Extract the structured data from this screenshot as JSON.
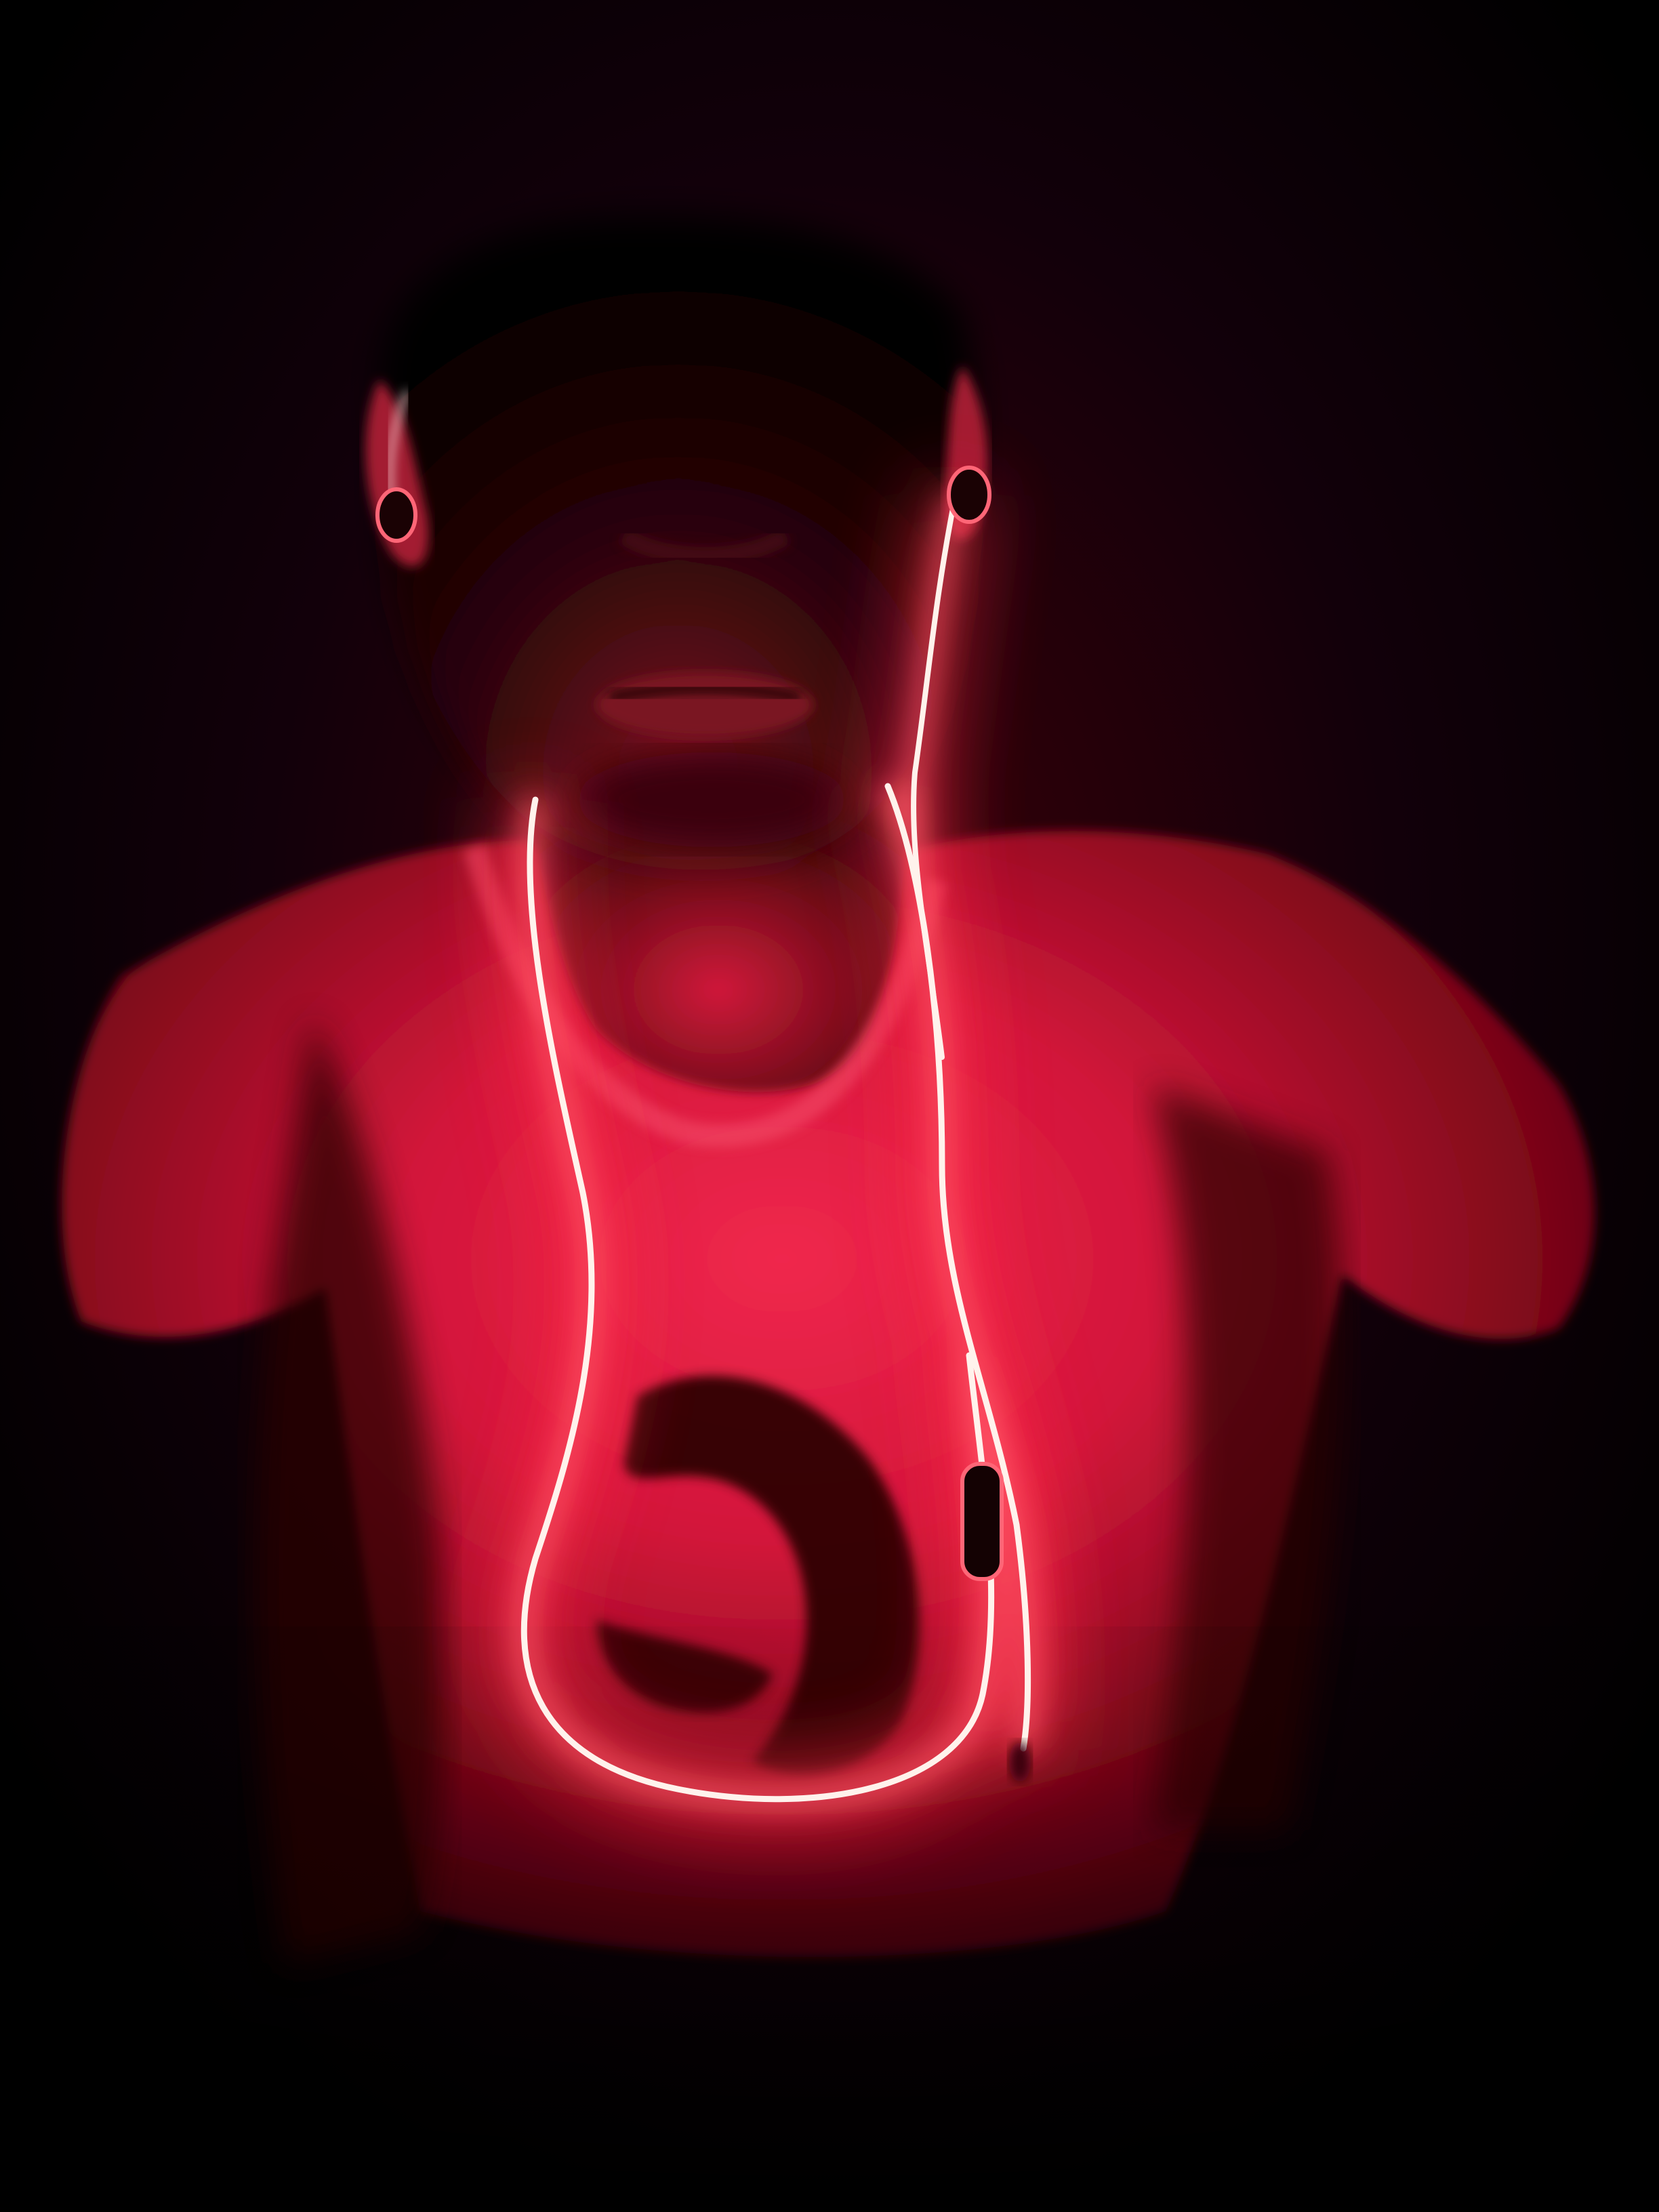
{
  "photo": {
    "subject": "person-with-glowing-earphones",
    "colors": {
      "background": "#000000",
      "shadow": "#1a0003",
      "shirt_dark": "#5a0010",
      "shirt_mid": "#b3102e",
      "shirt_light": "#f0284d",
      "skin_shadow": "#2a0508",
      "skin_lit": "#8a1424",
      "cable_core": "#fff2ec",
      "cable_glow": "#ff2a44",
      "emblem": "#2a0306",
      "remote": "#140203"
    }
  }
}
